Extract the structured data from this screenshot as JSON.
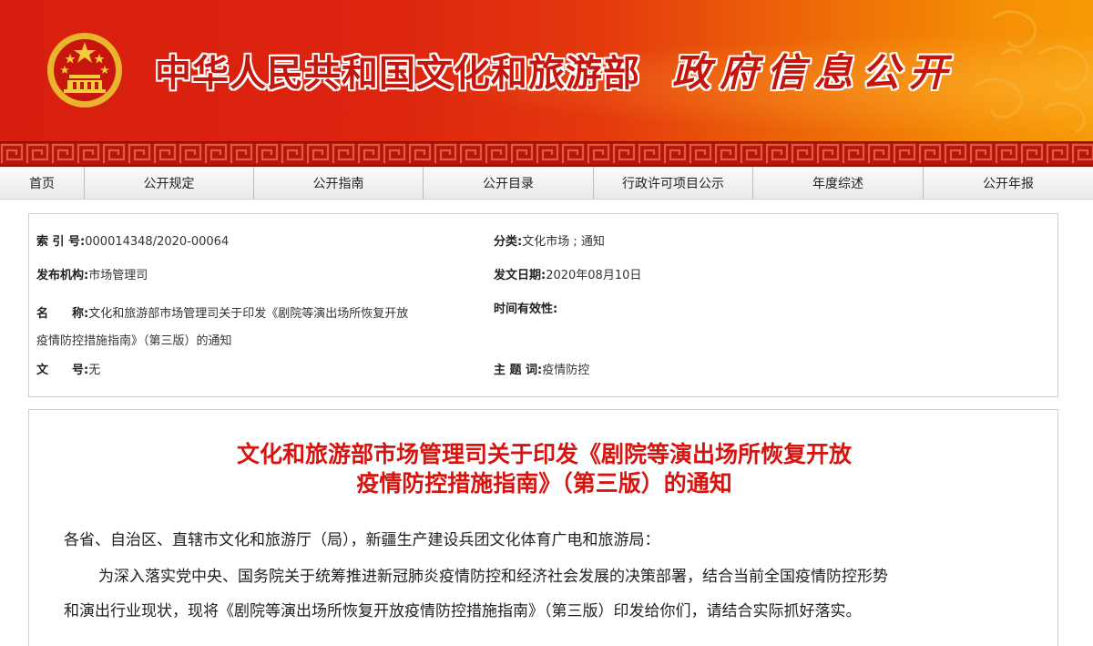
{
  "header": {
    "emblem_icon": "national-emblem-icon",
    "title": "中华人民共和国文化和旅游部",
    "subtitle": "政府信息公开"
  },
  "nav": {
    "items": [
      {
        "label": "首页"
      },
      {
        "label": "公开规定"
      },
      {
        "label": "公开指南"
      },
      {
        "label": "公开目录"
      },
      {
        "label": "行政许可项目公示"
      },
      {
        "label": "年度综述"
      },
      {
        "label": "公开年报"
      }
    ]
  },
  "info": {
    "index_label": "索 引 号:",
    "index_value": "000014348/2020-00064",
    "category_label": "分类:",
    "category_value": "文化市场 ; 通知",
    "issuer_label": "发布机构:",
    "issuer_value": "市场管理司",
    "date_label": "发文日期:",
    "date_value": "2020年08月10日",
    "name_label": "名　　称:",
    "name_value_line1": "文化和旅游部市场管理司关于印发《剧院等演出场所恢复开放",
    "name_value_line2": "疫情防控措施指南》（第三版）的通知",
    "validity_label": "时间有效性:",
    "doc_no_label": "文　　号:",
    "doc_no_value": "无",
    "subject_label": "主 题 词:",
    "subject_value": "疫情防控"
  },
  "article": {
    "title_line1": "文化和旅游部市场管理司关于印发《剧院等演出场所恢复开放",
    "title_line2": "疫情防控措施指南》（第三版）的通知",
    "salutation": "各省、自治区、直辖市文化和旅游厅（局），新疆生产建设兵团文化体育广电和旅游局：",
    "para1_line1": "为深入落实党中央、国务院关于统筹推进新冠肺炎疫情防控和经济社会发展的决策部署，结合当前全国疫情防控形势",
    "para1_line2": "和演出行业现状，现将《剧院等演出场所恢复开放疫情防控措施指南》（第三版）印发给你们，请结合实际抓好落实。"
  },
  "colors": {
    "banner_red": "#d81e0e",
    "banner_orange": "#f79a06",
    "title_red": "#d7140f"
  }
}
